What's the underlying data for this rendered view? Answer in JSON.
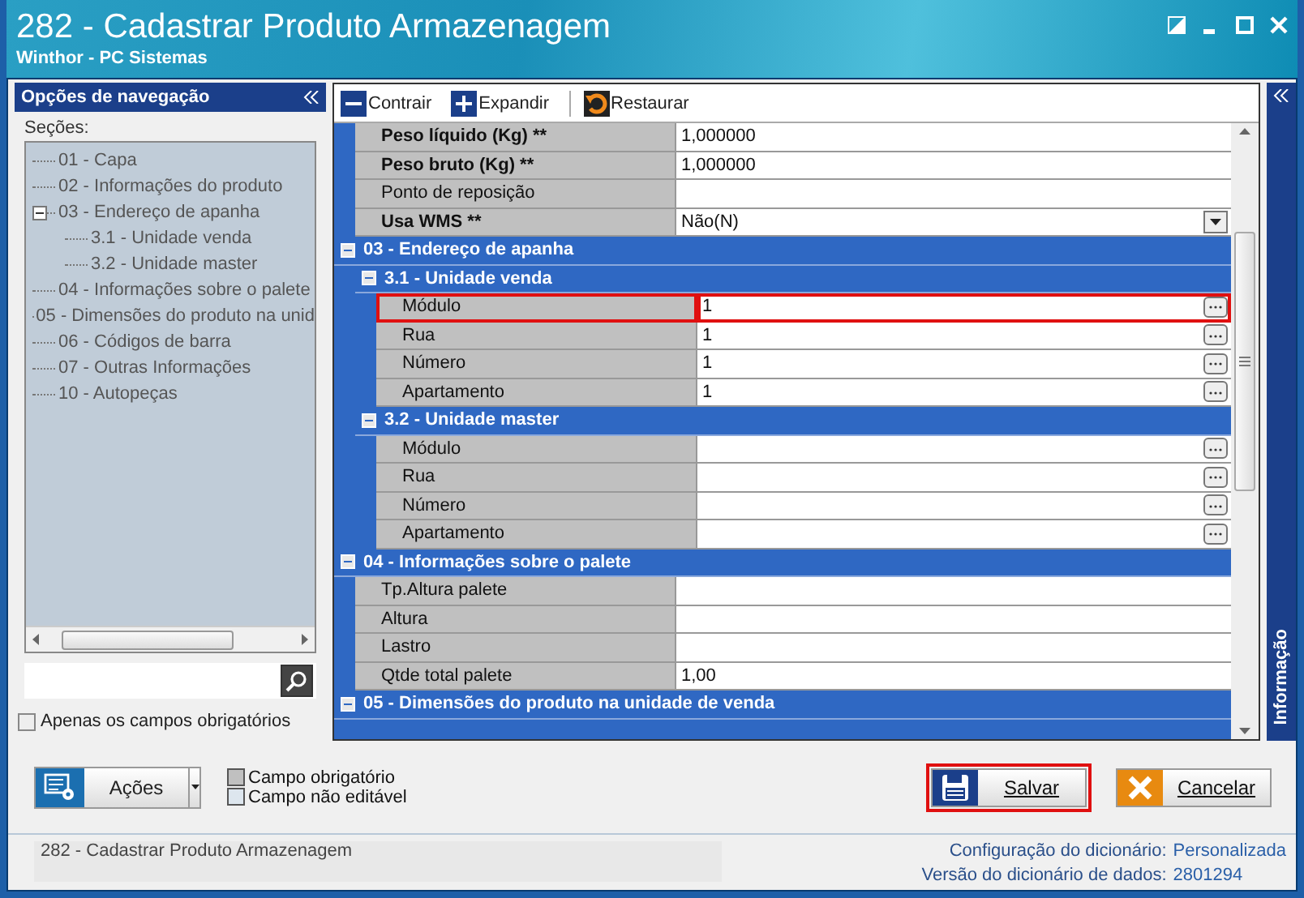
{
  "window": {
    "title": "282 - Cadastrar Produto Armazenagem",
    "subtitle": "Winthor - PC Sistemas"
  },
  "nav": {
    "title": "Opções de navegação",
    "sections_label": "Seções:",
    "tree": [
      {
        "label": "01 - Capa"
      },
      {
        "label": "02 - Informações do produto"
      },
      {
        "label": "03 - Endereço de apanha",
        "expanded": true,
        "children": [
          {
            "label": "3.1 - Unidade venda"
          },
          {
            "label": "3.2 - Unidade master"
          }
        ]
      },
      {
        "label": "04 - Informações sobre o palete"
      },
      {
        "label": "05 - Dimensões do produto na unid"
      },
      {
        "label": "06 - Códigos de barra"
      },
      {
        "label": "07 - Outras Informações"
      },
      {
        "label": "10 - Autopeças"
      }
    ],
    "required_only": {
      "label": "Apenas os campos obrigatórios",
      "checked": false
    }
  },
  "toolbar": [
    {
      "kind": "collapse",
      "label": "Contrair"
    },
    {
      "kind": "expand",
      "label": "Expandir"
    },
    {
      "kind": "restore",
      "label": "Restaurar"
    }
  ],
  "grid": [
    {
      "kind": "text",
      "label": "Peso líquido (Kg) **",
      "bold": true,
      "value": "1,000000"
    },
    {
      "kind": "text",
      "label": "Peso bruto (Kg) **",
      "bold": true,
      "value": "1,000000"
    },
    {
      "kind": "text",
      "label": "Ponto de reposição",
      "bold": false
    },
    {
      "kind": "dropdown",
      "label": "Usa WMS **",
      "bold": true,
      "value": "Não(N)"
    },
    {
      "kind": "group",
      "label": "03 - Endereço de apanha",
      "expanded": true,
      "children": [
        {
          "kind": "group",
          "label": "3.1 - Unidade venda",
          "expanded": true,
          "children": [
            {
              "kind": "lookup",
              "label": "Módulo",
              "bold": false,
              "value": "1",
              "highlighted": true
            },
            {
              "kind": "lookup",
              "label": "Rua",
              "bold": false,
              "value": "1",
              "highlighted": false
            },
            {
              "kind": "lookup",
              "label": "Número",
              "bold": false,
              "value": "1",
              "highlighted": false
            },
            {
              "kind": "lookup",
              "label": "Apartamento",
              "bold": false,
              "value": "1",
              "highlighted": false
            }
          ]
        },
        {
          "kind": "group",
          "label": "3.2 - Unidade master",
          "expanded": true,
          "children": [
            {
              "kind": "lookup",
              "label": "Módulo",
              "bold": false,
              "highlighted": false
            },
            {
              "kind": "lookup",
              "label": "Rua",
              "bold": false,
              "highlighted": false
            },
            {
              "kind": "lookup",
              "label": "Número",
              "bold": false,
              "highlighted": false
            },
            {
              "kind": "lookup",
              "label": "Apartamento",
              "bold": false,
              "highlighted": false
            }
          ]
        }
      ]
    },
    {
      "kind": "group",
      "label": "04 - Informações sobre o palete",
      "expanded": true,
      "children": [
        {
          "kind": "text",
          "label": "Tp.Altura palete",
          "bold": false
        },
        {
          "kind": "text",
          "label": "Altura",
          "bold": false
        },
        {
          "kind": "text",
          "label": "Lastro",
          "bold": false
        },
        {
          "kind": "text",
          "label": "Qtde total palete",
          "bold": false,
          "value": "1,00"
        }
      ]
    },
    {
      "kind": "group",
      "label": "05 - Dimensões do produto na unidade de venda",
      "expanded": true
    }
  ],
  "side_panel": {
    "label": "Informação"
  },
  "actions_button": {
    "label": "Ações"
  },
  "legend": [
    {
      "kind": "required",
      "label": "Campo obrigatório"
    },
    {
      "kind": "readonly",
      "label": "Campo não editável"
    }
  ],
  "buttons": [
    {
      "kind": "save",
      "label": "Salvar",
      "highlighted": true
    },
    {
      "kind": "cancel",
      "label": "Cancelar",
      "highlighted": false
    }
  ],
  "status_bar": {
    "text": "282 - Cadastrar Produto Armazenagem",
    "config_label": "Configuração do dicionário:",
    "config_value": "Personalizada",
    "version_label": "Versão do dicionário de dados:",
    "version_value": "2801294"
  }
}
